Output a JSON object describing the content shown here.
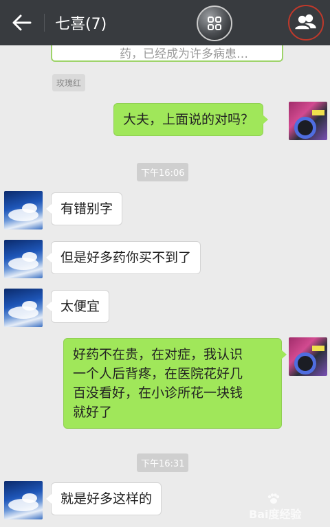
{
  "header": {
    "title": "七喜(7)"
  },
  "messages": {
    "prev_text": "药，已经成为许多病患…",
    "nickname": "玫瑰红",
    "m1": "大夫，上面说的对吗？",
    "time1": "下午16:06",
    "m2": "有错别字",
    "m3": "但是好多药你买不到了",
    "m4": "太便宜",
    "m5_l1": "好药不在贵，在对症，我认识",
    "m5_l2": "一个人后背疼，在医院花好几",
    "m5_l3": "百没看好，在小诊所花一块钱",
    "m5_l4": "就好了",
    "time2": "下午16:31",
    "m6": "就是好多这样的"
  },
  "watermark": {
    "text": "Bai度经验"
  },
  "colors": {
    "header_bg": "#383b3f",
    "chat_bg": "#ebebeb",
    "sent_bubble": "#a0e75a",
    "received_bubble": "#ffffff"
  }
}
